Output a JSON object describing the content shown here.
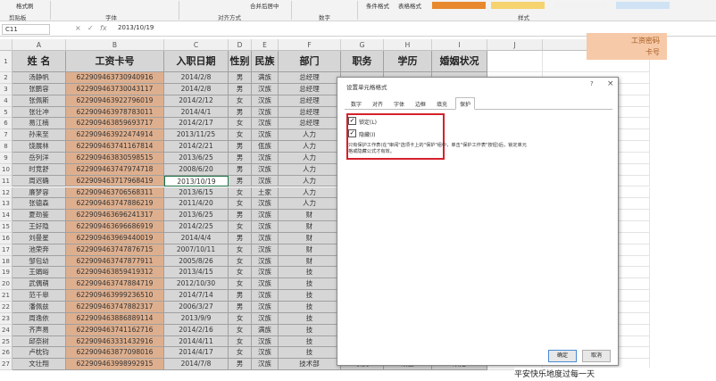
{
  "ribbon": {
    "groups": [
      "剪贴板",
      "字体",
      "对齐方式",
      "数字",
      "样式"
    ],
    "items": [
      "格式刷",
      "合并后居中",
      "条件格式",
      "表格格式"
    ],
    "swatch_colors": [
      "#e8892e",
      "#f6d36e",
      "#f2f2f2",
      "#cfe3f5"
    ]
  },
  "formula_bar": {
    "name_box": "C11",
    "cancel_icon": "×",
    "enter_icon": "✓",
    "fx": "fx",
    "value": "2013/10/19"
  },
  "columns": [
    "A",
    "B",
    "C",
    "D",
    "E",
    "F",
    "G",
    "H",
    "I",
    "J",
    "K"
  ],
  "headers": [
    "姓 名",
    "工资卡号",
    "入职日期",
    "性别",
    "民族",
    "部门",
    "职务",
    "学历",
    "婚姻状况"
  ],
  "rows": [
    [
      "汤静帆",
      "622909463730940916",
      "2014/2/8",
      "男",
      "满族",
      "总经理",
      "",
      "",
      ""
    ],
    [
      "张鹏容",
      "622909463730043117",
      "2014/2/8",
      "男",
      "汉族",
      "总经理",
      "",
      "",
      ""
    ],
    [
      "张佩斯",
      "622909463922796019",
      "2014/2/12",
      "女",
      "汉族",
      "总经理",
      "",
      "",
      ""
    ],
    [
      "张壮冲",
      "622909463978783011",
      "2014/4/1",
      "男",
      "汉族",
      "总经理",
      "",
      "",
      ""
    ],
    [
      "易江楠",
      "622909463859693717",
      "2014/2/17",
      "女",
      "汉族",
      "总经理",
      "",
      "",
      ""
    ],
    [
      "孙来至",
      "622909463922474914",
      "2013/11/25",
      "女",
      "汉族",
      "人力",
      "",
      "",
      ""
    ],
    [
      "饶展林",
      "622909463741167814",
      "2014/2/21",
      "男",
      "佤族",
      "人力",
      "",
      "",
      ""
    ],
    [
      "岳列洋",
      "622909463830598515",
      "2013/6/25",
      "男",
      "汉族",
      "人力",
      "",
      "",
      ""
    ],
    [
      "时竞舒",
      "622909463747974718",
      "2008/6/20",
      "男",
      "汉族",
      "人力",
      "",
      "",
      ""
    ],
    [
      "周迟确",
      "622909463717968419",
      "2013/10/19",
      "男",
      "汉族",
      "人力",
      "",
      "",
      ""
    ],
    [
      "廉梦容",
      "622909463706568311",
      "2013/6/15",
      "女",
      "土家",
      "人力",
      "",
      "",
      ""
    ],
    [
      "张德森",
      "622909463747886219",
      "2011/4/20",
      "女",
      "汉族",
      "人力",
      "",
      "",
      ""
    ],
    [
      "夏劲鉴",
      "622909463696241317",
      "2013/6/25",
      "男",
      "汉族",
      "财",
      "",
      "",
      ""
    ],
    [
      "王好隐",
      "622909463696686919",
      "2014/2/25",
      "女",
      "汉族",
      "财",
      "",
      "",
      ""
    ],
    [
      "刘曼星",
      "622909463969440019",
      "2014/4/4",
      "男",
      "汉族",
      "财",
      "",
      "",
      ""
    ],
    [
      "池荣奔",
      "622909463747876715",
      "2007/10/11",
      "女",
      "汉族",
      "财",
      "",
      "",
      ""
    ],
    [
      "邹包幼",
      "622909463747877911",
      "2005/8/26",
      "女",
      "汉族",
      "财",
      "",
      "",
      ""
    ],
    [
      "王娟峪",
      "622909463859419312",
      "2013/4/15",
      "女",
      "汉族",
      "技",
      "",
      "",
      ""
    ],
    [
      "武偶萌",
      "622909463747884719",
      "2012/10/30",
      "女",
      "汉族",
      "技",
      "",
      "",
      ""
    ],
    [
      "范千皋",
      "622909463999236510",
      "2014/7/14",
      "男",
      "汉族",
      "技",
      "",
      "",
      ""
    ],
    [
      "潘佩兹",
      "622909463747882317",
      "2006/3/27",
      "男",
      "汉族",
      "技",
      "",
      "",
      ""
    ],
    [
      "周逸依",
      "622909463886889114",
      "2013/9/9",
      "女",
      "汉族",
      "技",
      "",
      "",
      ""
    ],
    [
      "齐声易",
      "622909463741162716",
      "2014/2/16",
      "女",
      "满族",
      "技",
      "",
      "",
      ""
    ],
    [
      "邱奈树",
      "622909463331432916",
      "2014/4/11",
      "女",
      "汉族",
      "技",
      "",
      "",
      ""
    ],
    [
      "卢枕钧",
      "622909463877098016",
      "2014/4/17",
      "女",
      "汉族",
      "技",
      "",
      "",
      ""
    ],
    [
      "文壮翔",
      "622909463998992915",
      "2014/7/8",
      "男",
      "汉族",
      "技术部",
      "职员",
      "硕士",
      "未婚"
    ]
  ],
  "side_note": {
    "line1": "工资密码",
    "line2": "卡号"
  },
  "dialog": {
    "title": "设置单元格格式",
    "help": "?",
    "close": "×",
    "tabs": [
      "数字",
      "对齐",
      "字体",
      "边框",
      "填充",
      "保护"
    ],
    "active_tab": "保护",
    "locked_label": "锁定(L)",
    "hidden_label": "隐藏(I)",
    "locked_checked": "✓",
    "hidden_checked": "✓",
    "description": "只有保护工作表(在\"审阅\"选项卡上的\"保护\"组中，单击\"保护工作表\"按钮)后，锁定单元格或隐藏公式才有效。",
    "ok": "确定",
    "cancel": "取消"
  },
  "bottom_text": "平安快乐地度过每一天"
}
